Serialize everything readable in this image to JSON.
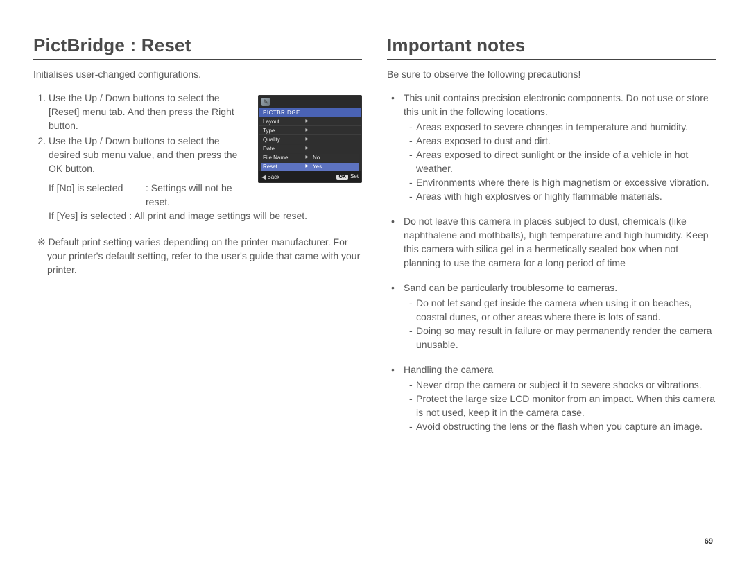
{
  "left": {
    "title": "PictBridge : Reset",
    "intro": "Initialises user-changed configurations.",
    "steps": [
      "Use the Up / Down buttons to select the [Reset] menu tab. And then press the Right button.",
      "Use the Up / Down buttons to select the desired sub menu value, and then press the OK button."
    ],
    "if_no_key": "If [No] is selected",
    "if_no_val": ": Settings will not be reset.",
    "if_yes": "If [Yes] is selected : All print and image settings will be reset.",
    "footnote": "※ Default print setting varies depending on the printer manufacturer. For your printer's default setting, refer to the user's guide that came with your printer.",
    "menu": {
      "header": "PICTBRIDGE",
      "rows": [
        "Layout",
        "Type",
        "Quality",
        "Date",
        "File Name",
        "Reset"
      ],
      "right_no": "No",
      "right_yes": "Yes",
      "back_label": "Back",
      "ok_key": "OK",
      "set_label": "Set"
    }
  },
  "right": {
    "title": "Important notes",
    "intro": "Be sure to observe the following precautions!",
    "b1_text": "This unit contains precision electronic components. Do not use or store this unit in the following locations.",
    "b1_sub": [
      "Areas exposed to severe changes in temperature and humidity.",
      "Areas exposed to dust and dirt.",
      "Areas exposed to direct sunlight or the inside of a vehicle in hot weather.",
      "Environments where there is high magnetism or excessive vibration.",
      "Areas with high explosives or highly flammable materials."
    ],
    "b2_text": "Do not leave this camera in places subject to dust, chemicals (like naphthalene and mothballs), high temperature and high humidity. Keep this camera with silica gel in a hermetically sealed box when not planning to use the camera for a long period of time",
    "b3_text": "Sand can be particularly troublesome to cameras.",
    "b3_sub": [
      "Do not let sand get inside the camera when using it on beaches, coastal dunes, or other areas where there is lots of sand.",
      "Doing so may result in failure or may permanently render the camera unusable."
    ],
    "b4_text": "Handling the camera",
    "b4_sub": [
      "Never drop the camera or subject it to severe shocks or vibrations.",
      "Protect  the large size LCD monitor from an impact. When this camera is not used, keep it in the camera case.",
      "Avoid obstructing the lens or the flash when you capture an image."
    ]
  },
  "page_number": "69"
}
